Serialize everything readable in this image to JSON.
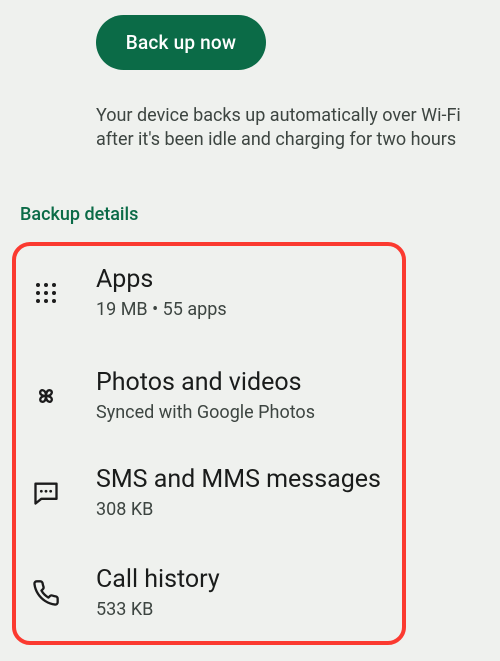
{
  "button": {
    "backup_now": "Back up now"
  },
  "info_text": "Your device backs up automatically over Wi-Fi after it's been idle and charging for two hours",
  "section_title": "Backup details",
  "rows": {
    "apps": {
      "title": "Apps",
      "subtitle": "19 MB • 55 apps"
    },
    "photos": {
      "title": "Photos and videos",
      "subtitle": "Synced with Google Photos"
    },
    "sms": {
      "title": "SMS and MMS messages",
      "subtitle": "308 KB"
    },
    "calls": {
      "title": "Call history",
      "subtitle": "533 KB"
    }
  }
}
